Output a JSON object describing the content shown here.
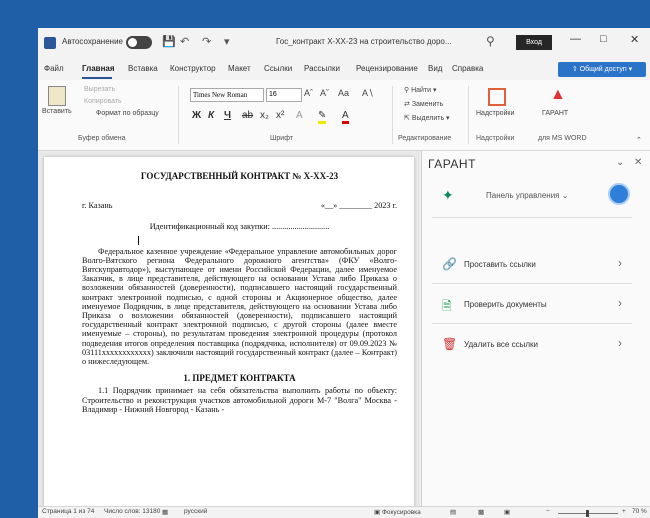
{
  "titlebar": {
    "autosave_label": "Автосохранение",
    "doc_title": "Гос_контракт X-XX-23 на строительство доро... ",
    "signin_label": "Вход"
  },
  "menu": {
    "tabs": [
      "Файл",
      "Главная",
      "Вставка",
      "Конструктор",
      "Макет",
      "Ссылки",
      "Рассылки",
      "Рецензирование",
      "Вид",
      "Справка"
    ],
    "share_label": "Общий доступ"
  },
  "ribbon": {
    "paste_label": "Вставить",
    "cut_label": "Вырезать",
    "copy_label": "Копировать",
    "format_painter_label": "Формат по образцу",
    "font_name": "Times New Roman",
    "font_size": "16",
    "find_label": "Найти",
    "replace_label": "Заменить",
    "select_label": "Выделить",
    "addins_label": "Надстройки",
    "garant_label": "ГАРАНТ",
    "groups": {
      "clipboard": "Буфер обмена",
      "font": "Шрифт",
      "editing": "Редактирование",
      "addins": "Надстройки",
      "ms_word": "для MS WORD"
    }
  },
  "document": {
    "title": "ГОСУДАРСТВЕННЫЙ КОНТРАКТ № X-XX-23",
    "city": "г. Казань",
    "date": "«__» ________ 2023 г.",
    "id_code": "Идентификационный код закупки: ............................",
    "para1": "Федеральное казенное учреждение «Федеральное управление автомобильных дорог Волго-Вятского региона Федерального дорожного агентства» (ФКУ «Волго-Вятскуправтодор»), выступающее от имени Российской Федерации, далее именуемое Заказчик, в лице представителя, действующего на основании Устава либо Приказа о возложении обязанностей (доверенности), подписавшего настоящий государственный контракт электронной подписью, с одной стороны и Акционерное общество, далее именуемое Подрядчик, в лице представителя, действующего на основании Устава либо Приказа о возложении обязанностей (доверенности), подписавшего настоящий государственный контракт электронной подписью, с другой стороны (далее вместе именуемые – стороны), по результатам проведения электронной процедуры (протокол подведения итогов определения поставщика (подрядчика, исполнителя) от 09.09.2023 № 03111xxxxxxxxxxxx) заключили настоящий государственный контракт (далее – Контракт) о нижеследующем.",
    "section1_title": "1. ПРЕДМЕТ КОНТРАКТА",
    "para2": "1.1 Подрядчик принимает на себя обязательства выполнить работы по объекту: Строительство и реконструкция участков автомобильной дороги М-7 \"Волга\" Москва - Владимир - Нижний Новгород - Казань -"
  },
  "pane": {
    "title": "ГАРАНТ",
    "panel_label": "Панель управления",
    "items": [
      {
        "label": "Проставить ссылки"
      },
      {
        "label": "Проверить документы"
      },
      {
        "label": "Удалить все ссылки"
      }
    ]
  },
  "status": {
    "page": "Страница 1 из 74",
    "words": "Число слов: 13180",
    "language": "русский",
    "focus": "Фокусировка",
    "zoom": "70 %"
  }
}
